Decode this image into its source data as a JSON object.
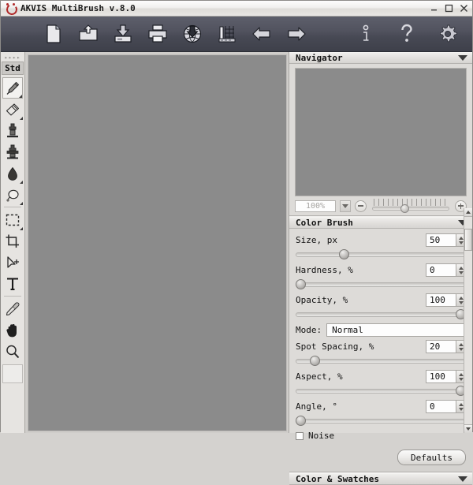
{
  "window": {
    "title": "AKVIS MultiBrush v.8.0",
    "logo_icon": "akvis-logo-icon",
    "minimize_label": "–",
    "maximize_label": "□",
    "close_label": "×"
  },
  "toolbar": {
    "items": [
      {
        "name": "new-document",
        "icon": "new-document-icon"
      },
      {
        "name": "open-image",
        "icon": "open-folder-up-icon"
      },
      {
        "name": "save-image",
        "icon": "save-down-icon"
      },
      {
        "name": "print-image",
        "icon": "printer-icon"
      },
      {
        "name": "load-from-web",
        "icon": "globe-download-icon"
      },
      {
        "name": "image-adjust",
        "icon": "chart-grid-icon"
      },
      {
        "name": "undo",
        "icon": "arrow-left-icon"
      },
      {
        "name": "redo",
        "icon": "arrow-right-icon"
      }
    ],
    "right_items": [
      {
        "name": "about-info",
        "icon": "info-icon"
      },
      {
        "name": "help",
        "icon": "question-mark-icon"
      },
      {
        "name": "preferences",
        "icon": "gear-icon"
      }
    ]
  },
  "tools": {
    "grip_label": "▸▸▸▸",
    "mode_label": "Std",
    "items": [
      {
        "name": "brush-tool",
        "icon": "paintbrush-icon",
        "selected": true,
        "has_submenu": true
      },
      {
        "name": "eraser-tool",
        "icon": "eraser-icon",
        "selected": false,
        "has_submenu": true
      },
      {
        "name": "clone-stamp-tool",
        "icon": "stamp-icon",
        "selected": false,
        "has_submenu": false
      },
      {
        "name": "pattern-stamp-tool",
        "icon": "stamp-filled-icon",
        "selected": false,
        "has_submenu": false
      },
      {
        "name": "blur-drop-tool",
        "icon": "water-drop-icon",
        "selected": false,
        "has_submenu": true
      },
      {
        "name": "patch-tool",
        "icon": "lasso-patch-icon",
        "selected": false,
        "has_submenu": true
      },
      {
        "name": "rectangular-select-tool",
        "icon": "marquee-select-icon",
        "selected": false,
        "has_submenu": true
      },
      {
        "name": "crop-tool",
        "icon": "crop-icon",
        "selected": false,
        "has_submenu": false
      },
      {
        "name": "move-tool",
        "icon": "move-arrow-icon",
        "selected": false,
        "has_submenu": false
      },
      {
        "name": "text-tool",
        "icon": "text-t-icon",
        "selected": false,
        "has_submenu": false
      },
      {
        "name": "eyedropper-tool",
        "icon": "eyedropper-icon",
        "selected": false,
        "has_submenu": false
      },
      {
        "name": "hand-tool",
        "icon": "hand-icon",
        "selected": false,
        "has_submenu": false
      },
      {
        "name": "zoom-tool",
        "icon": "magnifier-icon",
        "selected": false,
        "has_submenu": false
      }
    ]
  },
  "navigator": {
    "title": "Navigator",
    "collapse_icon": "chevron-down-icon",
    "zoom_value": "100%",
    "zoom_out_icon": "minus-circle-icon",
    "zoom_in_icon": "plus-circle-icon",
    "slider_percent": 42
  },
  "color_brush": {
    "title": "Color Brush",
    "collapse_icon": "chevron-down-icon",
    "controls": [
      {
        "name": "size",
        "label": "Size, px",
        "value": "50",
        "slider_percent": 27
      },
      {
        "name": "hardness",
        "label": "Hardness, %",
        "value": "0",
        "slider_percent": 0
      },
      {
        "name": "opacity",
        "label": "Opacity, %",
        "value": "100",
        "slider_percent": 100
      },
      {
        "name": "spot-spacing",
        "label": "Spot Spacing, %",
        "value": "20",
        "slider_percent": 9
      },
      {
        "name": "aspect",
        "label": "Aspect, %",
        "value": "100",
        "slider_percent": 100
      },
      {
        "name": "angle",
        "label": "Angle, °",
        "value": "0",
        "slider_percent": 0
      }
    ],
    "mode_label": "Mode:",
    "mode_value": "Normal",
    "noise_label": "Noise",
    "noise_checked": false,
    "defaults_label": "Defaults"
  },
  "color_swatches": {
    "title": "Color & Swatches",
    "collapse_icon": "chevron-down-icon"
  },
  "colors": {
    "titlebar_bg": "#eeecea",
    "toolbar_bg": "#4a4c57",
    "canvas_bg": "#8b8b8b",
    "panel_bg": "#dddbd8",
    "logo_red": "#b02a2a"
  }
}
